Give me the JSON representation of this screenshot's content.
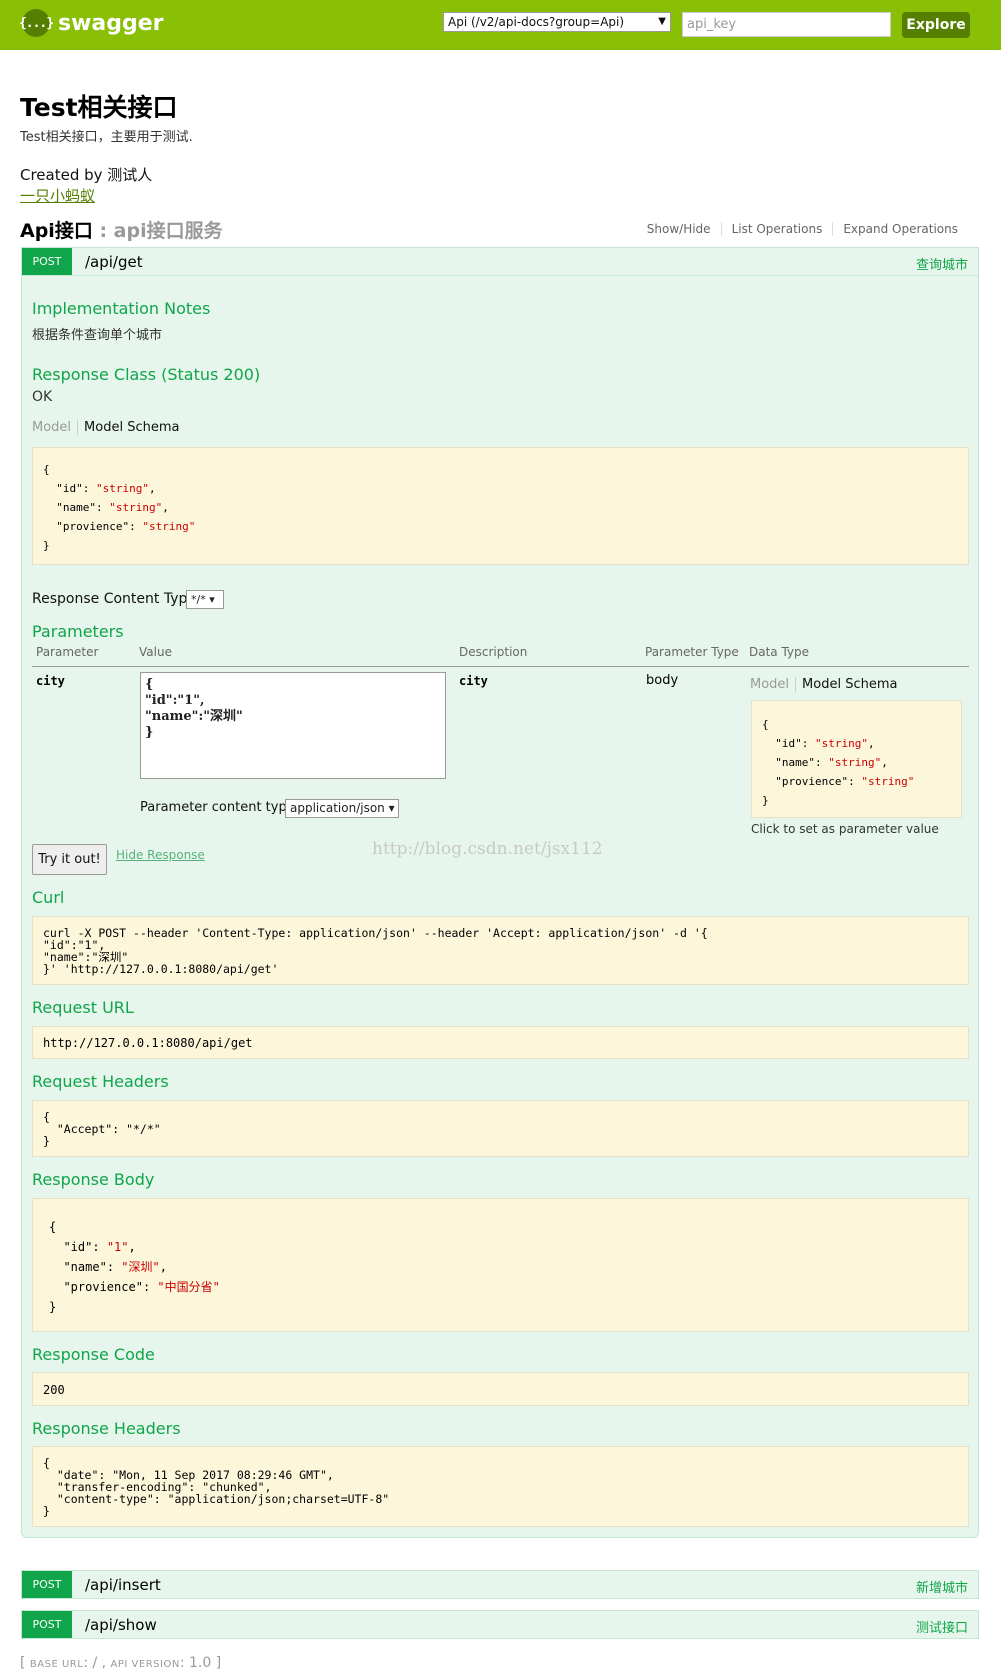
{
  "header": {
    "logo_text": "swagger",
    "logo_glyph": "{...}",
    "api_select_value": "Api (/v2/api-docs?group=Api)",
    "api_key_placeholder": "api_key",
    "explore_label": "Explore"
  },
  "info": {
    "title": "Test相关接口",
    "description": "Test相关接口，主要用于测试.",
    "created_by": "Created by 测试人",
    "contact_link": "一只小蚂蚁"
  },
  "resource": {
    "name": "Api接口",
    "separator": " : ",
    "description": "api接口服务",
    "options": [
      "Show/Hide",
      "List Operations",
      "Expand Operations"
    ]
  },
  "operations": [
    {
      "method": "POST",
      "path": "/api/get",
      "summary": "查询城市"
    },
    {
      "method": "POST",
      "path": "/api/insert",
      "summary": "新增城市"
    },
    {
      "method": "POST",
      "path": "/api/show",
      "summary": "测试接口"
    }
  ],
  "op_detail": {
    "impl_notes_title": "Implementation Notes",
    "impl_notes": "根据条件查询单个城市",
    "response_class_title": "Response Class (Status 200)",
    "response_class_value": "OK",
    "tab_model": "Model",
    "tab_schema": "Model Schema",
    "schema_fields": [
      {
        "key": "\"id\"",
        "value": "\"string\""
      },
      {
        "key": "\"name\"",
        "value": "\"string\""
      },
      {
        "key": "\"provience\"",
        "value": "\"string\""
      }
    ],
    "response_content_type_label": "Response Content Type",
    "response_content_type_value": "*/*",
    "parameters_title": "Parameters",
    "param_headers": [
      "Parameter",
      "Value",
      "Description",
      "Parameter Type",
      "Data Type"
    ],
    "param": {
      "name": "city",
      "value": "{\n\"id\":\"1\",\n\"name\":\"深圳\"\n}",
      "description": "city",
      "type": "body",
      "click_hint": "Click to set as parameter value"
    },
    "param_content_type_label": "Parameter content type:",
    "param_content_type_value": "application/json",
    "try_label": "Try it out!",
    "hide_response_label": "Hide Response",
    "curl_title": "Curl",
    "curl": "curl -X POST --header 'Content-Type: application/json' --header 'Accept: application/json' -d '{\n\"id\":\"1\",\n\"name\":\"深圳\"\n}' 'http://127.0.0.1:8080/api/get'",
    "request_url_title": "Request URL",
    "request_url": "http://127.0.0.1:8080/api/get",
    "request_headers_title": "Request Headers",
    "request_headers": "{\n  \"Accept\": \"*/*\"\n}",
    "response_body_title": "Response Body",
    "response_body_fields": [
      {
        "key": "\"id\"",
        "value": "\"1\""
      },
      {
        "key": "\"name\"",
        "value": "\"深圳\""
      },
      {
        "key": "\"provience\"",
        "value": "\"中国分省\""
      }
    ],
    "response_code_title": "Response Code",
    "response_code": "200",
    "response_headers_title": "Response Headers",
    "response_headers": "{\n  \"date\": \"Mon, 11 Sep 2017 08:29:46 GMT\",\n  \"transfer-encoding\": \"chunked\",\n  \"content-type\": \"application/json;charset=UTF-8\"\n}"
  },
  "watermark": "http://blog.csdn.net/jsx112",
  "footer": {
    "open": "[ ",
    "base_url_label": "BASE URL",
    "base_url": ": / , ",
    "api_version_label": "API VERSION",
    "api_version": ": 1.0 ]"
  }
}
